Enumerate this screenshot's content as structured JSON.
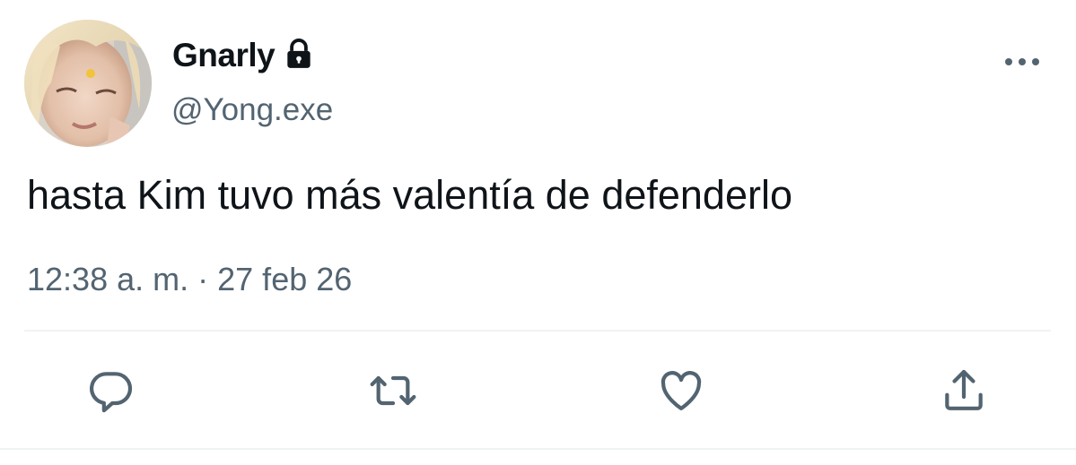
{
  "user": {
    "display_name": "Gnarly",
    "handle": "@Yong.exe",
    "protected_icon": "lock-icon",
    "avatar": "profile photo"
  },
  "tweet": {
    "text": "hasta Kim tuvo más valentía de defenderlo",
    "time": "12:38 a. m.",
    "separator": "·",
    "date": "27 feb 26"
  },
  "actions": [
    {
      "name": "reply",
      "icon": "reply-icon"
    },
    {
      "name": "retweet",
      "icon": "retweet-icon"
    },
    {
      "name": "like",
      "icon": "heart-icon"
    },
    {
      "name": "share",
      "icon": "share-icon"
    }
  ],
  "more_menu_icon": "more-icon",
  "colors": {
    "text_primary": "#0f1419",
    "text_secondary": "#536471",
    "divider": "#eff3f4"
  }
}
